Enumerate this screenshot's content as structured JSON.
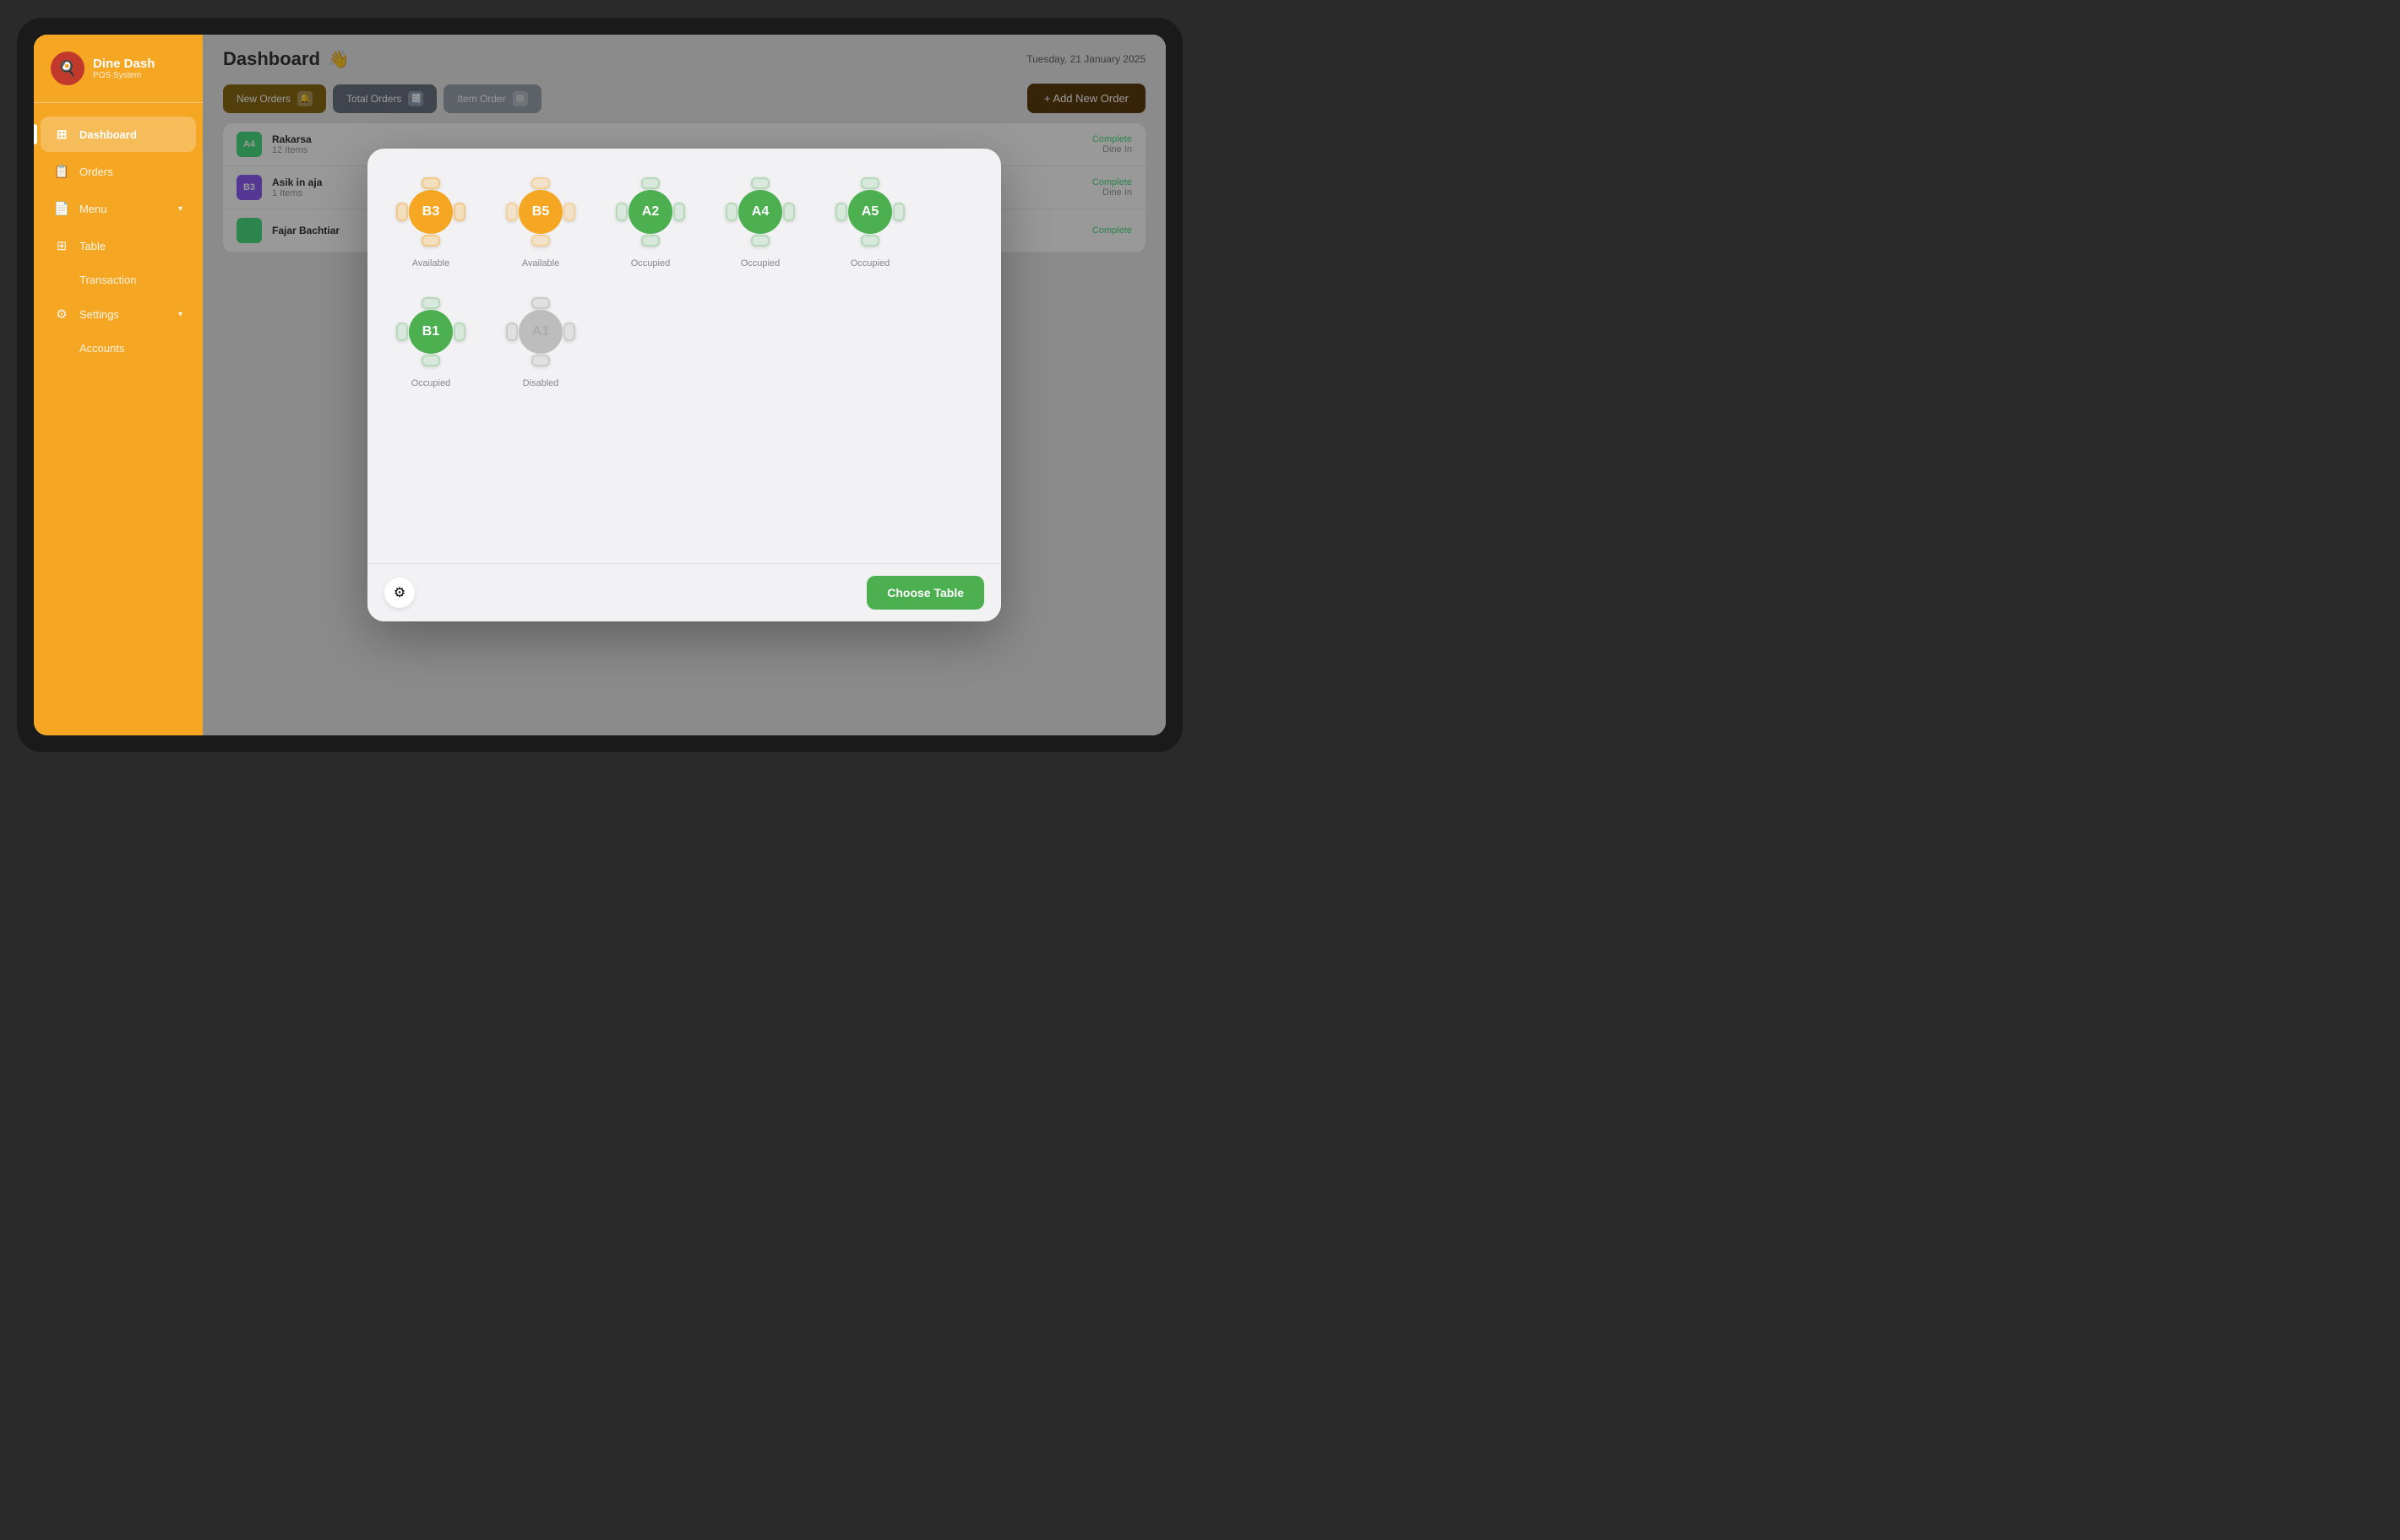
{
  "app": {
    "name": "Dine Dash",
    "subtitle": "POS System",
    "logo_emoji": "🍳"
  },
  "header": {
    "title": "Dashboard",
    "emoji": "👋",
    "date": "Tuesday, 21 January 2025"
  },
  "sidebar": {
    "items": [
      {
        "id": "dashboard",
        "label": "Dashboard",
        "icon": "⊞",
        "active": true
      },
      {
        "id": "orders",
        "label": "Orders",
        "icon": "📋",
        "active": false
      },
      {
        "id": "menu",
        "label": "Menu",
        "icon": "📄",
        "active": false,
        "has_chevron": true
      },
      {
        "id": "table",
        "label": "Table",
        "icon": "⊞",
        "active": false
      },
      {
        "id": "transaction",
        "label": "Transaction",
        "icon": "",
        "active": false
      },
      {
        "id": "settings",
        "label": "Settings",
        "icon": "⚙",
        "active": false,
        "has_chevron": true
      },
      {
        "id": "accounts",
        "label": "Accounts",
        "icon": "",
        "active": false
      }
    ]
  },
  "toolbar": {
    "new_orders_label": "New Orders",
    "total_orders_label": "Total Orders",
    "item_order_label": "Item Order",
    "add_order_label": "+ Add New Order"
  },
  "modal": {
    "tables": [
      {
        "id": "B3",
        "status": "Available",
        "color": "orange"
      },
      {
        "id": "B5",
        "status": "Available",
        "color": "orange"
      },
      {
        "id": "A2",
        "status": "Occupied",
        "color": "green"
      },
      {
        "id": "A4",
        "status": "Occupied",
        "color": "green"
      },
      {
        "id": "A5",
        "status": "Occupied",
        "color": "green"
      },
      {
        "id": "B1",
        "status": "Occupied",
        "color": "green"
      },
      {
        "id": "A1",
        "status": "Disabled",
        "color": "gray"
      }
    ],
    "choose_table_btn": "Choose Table"
  },
  "orders": [
    {
      "table": "A4",
      "name": "Rakarsa",
      "items": "12 Items",
      "status": "Complete",
      "type": "Dine In",
      "badge_color": "#4ade80"
    },
    {
      "table": "B3",
      "name": "Asik in aja",
      "items": "1 Items",
      "status": "Complete",
      "type": "Dine In",
      "badge_color": "#8b5cf6"
    },
    {
      "table": "",
      "name": "Fajar Bachtiar",
      "items": "",
      "status": "Complete",
      "type": "",
      "badge_color": "#4ade80"
    }
  ]
}
